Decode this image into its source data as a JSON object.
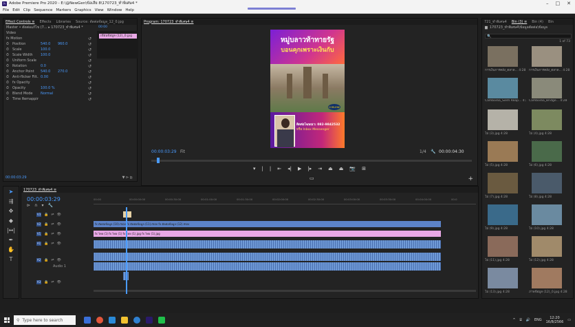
{
  "titlebar": {
    "title": "Adobe Premiere Pro 2020 - E:\\@NewGen\\ข้อเสีย 8\\170723_ทำพิเศษ4 *"
  },
  "menu": [
    "File",
    "Edit",
    "Clip",
    "Sequence",
    "Markers",
    "Graphics",
    "View",
    "Window",
    "Help"
  ],
  "effect_controls": {
    "tabs": [
      "Effect Controls ≡",
      "Effects",
      "Libraries"
    ],
    "source_tab": "Source: ตัดต่อข้อมูล_12_0.jpg",
    "master": "Master • ตัดต่อแก้ไข (7... ▸ 170723_ทำพิเศษ4 *",
    "video_label": "Video",
    "motion": "fx Motion",
    "rows": [
      {
        "name": "Position",
        "value": "540.0",
        "value2": "960.0"
      },
      {
        "name": "Scale",
        "value": "100.0",
        "value2": ""
      },
      {
        "name": "Scale Width",
        "value": "100.0",
        "value2": ""
      },
      {
        "name": "Uniform Scale",
        "value": "",
        "value2": ""
      },
      {
        "name": "Rotation",
        "value": "0.0",
        "value2": ""
      },
      {
        "name": "Anchor Point",
        "value": "540.0",
        "value2": "270.0"
      },
      {
        "name": "Anti-flicker Filt...",
        "value": "0.00",
        "value2": ""
      },
      {
        "name": "fx Opacity",
        "value": "",
        "value2": ""
      },
      {
        "name": "Opacity",
        "value": "100.0 %",
        "value2": ""
      },
      {
        "name": "Blend Mode",
        "value": "Normal",
        "value2": ""
      },
      {
        "name": "Time Remapping",
        "value": "",
        "value2": ""
      }
    ],
    "mini_clip": "เขียนข้อมูล (12)_0.jpg",
    "mini_time": "00:00",
    "footer_time": "00:00:03:29"
  },
  "program": {
    "tab": "Program: 170723_ทำพิเศษ4 ≡",
    "timecode": "00:00:03:29",
    "fit": "Fit",
    "quality": "1/4",
    "duration": "00:00:04:30",
    "poster": {
      "line1": "หมู่บลาวท้าทายรัฐ",
      "line2": "บอนคุกเพราะเงินกับ",
      "contact1": "ติดต่อโฆษณา: 082-9842532",
      "contact2": "หรือ Inbox Messenger",
      "badge": "CORLENE"
    }
  },
  "project": {
    "tabs": [
      "721_ทำพิเศษ4",
      "Bin (3) ≡",
      "Bin (4)",
      "Bin"
    ],
    "path": "170723_ทำพิเศษ4\\ข้อมูลตัดต่อ\\ข้อมูล",
    "count": "1 of 73",
    "search_placeholder": "🔍",
    "items": [
      {
        "label": "การเงินการคลัง_ตลาด...  4:28",
        "color": "#7a7060"
      },
      {
        "label": "การเงินการคลัง_ตลาด...  4:28",
        "color": "#9a9080"
      },
      {
        "label": "Cambodia_Siem Reap...  4:28",
        "color": "#5a8aa0"
      },
      {
        "label": "Cambodia_Bridge...  4:28",
        "color": "#8a8a7a"
      },
      {
        "label": "ไม่ (3).jpg  4:28",
        "color": "#b5b2a8"
      },
      {
        "label": "ไม่ (4).jpg  4:28",
        "color": "#7d8a60"
      },
      {
        "label": "ไม่ (5).jpg  4:28",
        "color": "#9a7a55"
      },
      {
        "label": "ไม่ (6).jpg  4:28",
        "color": "#4a6a4a"
      },
      {
        "label": "ไม่ (7).jpg  4:28",
        "color": "#6a5a40"
      },
      {
        "label": "ไม่ (8).jpg  4:28",
        "color": "#4a5a6a"
      },
      {
        "label": "ไม่ (9).jpg  4:28",
        "color": "#3a6a8a"
      },
      {
        "label": "ไม่ (10).jpg  4:28",
        "color": "#6a8aa0"
      },
      {
        "label": "ไม่ (11).jpg  4:28",
        "color": "#8a6a5a"
      },
      {
        "label": "ไม่ (12).jpg  4:28",
        "color": "#a08a6a"
      },
      {
        "label": "ไม่ (13).jpg  4:28",
        "color": "#7a8aa0"
      },
      {
        "label": "ภาพข้อมูล (12)_0.jpg  4:28",
        "color": "#a07a60"
      }
    ]
  },
  "timeline": {
    "tab": "170723_ทำพิเศษ4 ≡",
    "timecode": "00:00:03:29",
    "ruler": [
      "00:00",
      "00:00:00:00",
      "00:00:30:00",
      "00:01:00:00",
      "00:01:30:00",
      "00:02:00:00",
      "00:02:30:00",
      "00:03:00:00",
      "00:03:30:00",
      "00:04:00:00",
      "00:0"
    ],
    "tracks": [
      {
        "label": "V3"
      },
      {
        "label": "V2"
      },
      {
        "label": "V1"
      },
      {
        "label": "A1"
      },
      {
        "label": "A2"
      },
      {
        "label": "A3"
      }
    ],
    "audio_label": "Audio 1",
    "v2_text": "fx ตัดต่อข้อมูล (10).mov   fx ตัดต่อข้อมูล (11).mov   fx ตัดต่อข้อมูล (12).mov",
    "v1_text": "fx ไทย (1)   fx ไทย (1)   fx ไทย (1).jpg   fx ไทย (1).jpg"
  },
  "taskbar": {
    "search_placeholder": "Type here to search",
    "lang": "ENG",
    "time": "12:20",
    "date": "16/8/2566"
  }
}
